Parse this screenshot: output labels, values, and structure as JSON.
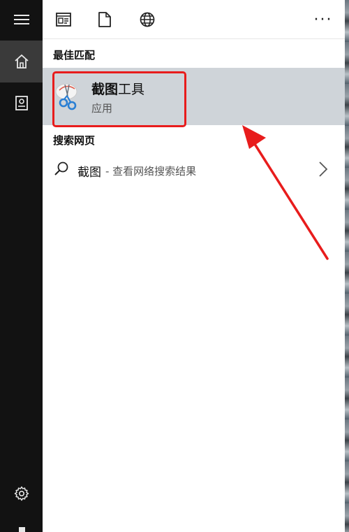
{
  "toolbar": {
    "more_label": "···"
  },
  "best_match": {
    "title": "最佳匹配",
    "app_name_bold": "截图",
    "app_name_rest": "工具",
    "app_type": "应用"
  },
  "web": {
    "title": "搜索网页",
    "query": "截图",
    "hint": "- 查看网络搜索结果"
  },
  "colors": {
    "rail": "#121212",
    "rail_active": "#3a3a3a",
    "highlight_row": "#cfd4d9",
    "annotation": "#e81c1c"
  },
  "icons": [
    "hamburger-menu-icon",
    "home-icon",
    "notebook-icon",
    "settings-icon",
    "document-view-icon",
    "file-icon",
    "globe-icon",
    "more-icon",
    "snipping-tool-icon",
    "search-icon",
    "chevron-right-icon"
  ]
}
